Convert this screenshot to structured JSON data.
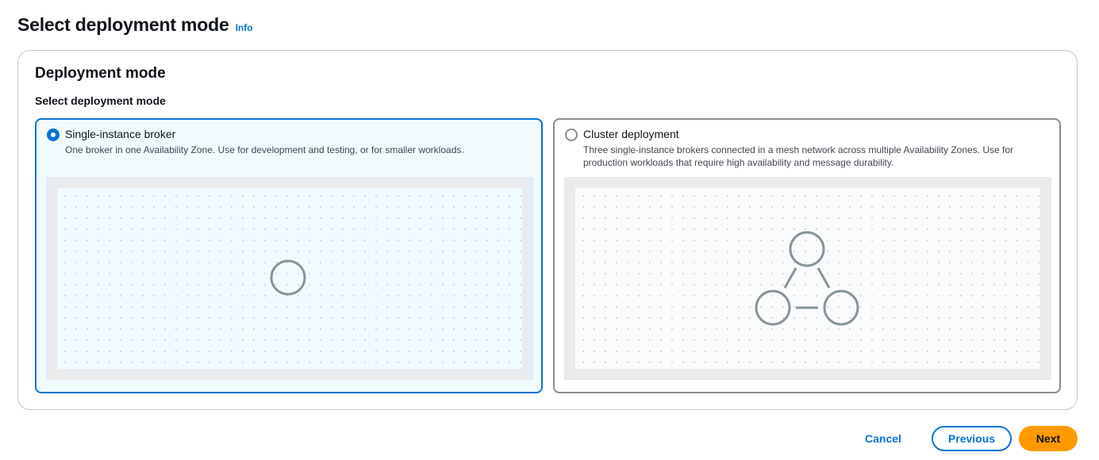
{
  "header": {
    "title": "Select deployment mode",
    "info_label": "Info"
  },
  "container": {
    "title": "Deployment mode",
    "field_label": "Select deployment mode"
  },
  "options": [
    {
      "label": "Single-instance broker",
      "description": "One broker in one Availability Zone. Use for development and testing, or for smaller workloads.",
      "selected": true,
      "diagram_nodes": 1
    },
    {
      "label": "Cluster deployment",
      "description": "Three single-instance brokers connected in a mesh network across multiple Availability Zones. Use for production workloads that require high availability and message durability.",
      "selected": false,
      "diagram_nodes": 3
    }
  ],
  "footer": {
    "cancel_label": "Cancel",
    "previous_label": "Previous",
    "next_label": "Next"
  },
  "colors": {
    "accent": "#0972d3",
    "primary_button": "#ff9900",
    "selected_tile_bg": "#f0fbff",
    "diagram_stroke": "#879596"
  }
}
